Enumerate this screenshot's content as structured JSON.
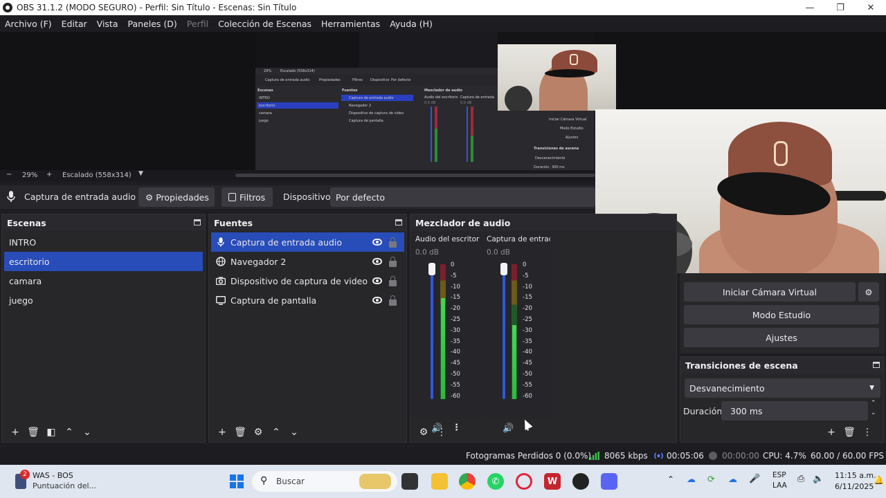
{
  "window": {
    "title": "OBS 31.1.2 (MODO SEGURO) - Perfil: Sin Título - Escenas: Sin Título",
    "controls": [
      "—",
      "❐",
      "✕"
    ]
  },
  "menu": [
    {
      "label": "Archivo (F)",
      "enabled": true
    },
    {
      "label": "Editar",
      "enabled": true
    },
    {
      "label": "Vista",
      "enabled": true
    },
    {
      "label": "Paneles (D)",
      "enabled": true
    },
    {
      "label": "Perfil",
      "enabled": false
    },
    {
      "label": "Colección de Escenas",
      "enabled": true
    },
    {
      "label": "Herramientas",
      "enabled": true
    },
    {
      "label": "Ayuda (H)",
      "enabled": true
    }
  ],
  "preview": {
    "zoom_minus": "−",
    "zoom_value": "29%",
    "zoom_plus": "+",
    "scaling": "Escalado (558x314)"
  },
  "source_toolbar": {
    "source_name": "Captura de entrada audio",
    "properties_label": "Propiedades",
    "filters_label": "Filtros",
    "device_label": "Dispositivo",
    "device_value": "Por defecto"
  },
  "scenes": {
    "title": "Escenas",
    "items": [
      {
        "label": "INTRO",
        "selected": false
      },
      {
        "label": "escritorio",
        "selected": true
      },
      {
        "label": "camara",
        "selected": false
      },
      {
        "label": "juego",
        "selected": false
      }
    ]
  },
  "sources": {
    "title": "Fuentes",
    "items": [
      {
        "label": "Captura de entrada audio",
        "icon": "microphone-icon",
        "selected": true
      },
      {
        "label": "Navegador 2",
        "icon": "globe-icon",
        "selected": false
      },
      {
        "label": "Dispositivo de captura de video",
        "icon": "camera-icon",
        "selected": false
      },
      {
        "label": "Captura de pantalla",
        "icon": "monitor-icon",
        "selected": false
      }
    ]
  },
  "mixer": {
    "title": "Mezclador de audio",
    "channels": [
      {
        "name": "Audio del escritorio",
        "db": "0.0 dB",
        "level": 0.75
      },
      {
        "name": "Captura de entrada audio",
        "db": "0.0 dB",
        "level": 0.55
      }
    ],
    "scale": [
      "0",
      "-5",
      "-10",
      "-15",
      "-20",
      "-25",
      "-30",
      "-35",
      "-40",
      "-45",
      "-50",
      "-55",
      "-60"
    ]
  },
  "controls": {
    "virtual_cam_label": "Iniciar Cámara Virtual",
    "studio_label": "Modo Estudio",
    "settings_label": "Ajustes"
  },
  "transitions": {
    "title": "Transiciones de escena",
    "selected": "Desvanecimiento",
    "duration_label": "Duración",
    "duration_value": "300 ms"
  },
  "status": {
    "dropped_frames": "Fotogramas Perdidos 0 (0.0%)",
    "bitrate": "8065 kbps",
    "stream_time": "00:05:06",
    "record_time": "00:00:00",
    "cpu": "CPU: 4.7%",
    "fps": "60.00 / 60.00 FPS"
  },
  "taskbar": {
    "notif_title": "WAS - BOS",
    "notif_sub": "Puntuación del...",
    "notif_badge": "2",
    "search_placeholder": "Buscar",
    "lang": "ESP",
    "lang2": "LAA",
    "time": "11:15 a.m.",
    "date": "6/11/2025"
  },
  "nested_preview": {
    "source_name": "Captura de entrada audio",
    "properties": "Propiedades",
    "filters": "Filtros",
    "device": "Dispositivo",
    "device_value": "Por defecto",
    "scenes": "Escenas",
    "sources": "Fuentes",
    "mixer": "Mezclador de audio",
    "scene_items": [
      "INTRO",
      "escritorio",
      "camara",
      "juego"
    ],
    "source_items": [
      "Captura de entrada audio",
      "Navegador 2",
      "Dispositivo de captura de video",
      "Captura de pantalla"
    ],
    "ch1": "Audio del escritorio",
    "ch2": "Captura de entrada",
    "db1": "0.0 dB",
    "db2": "0.0 dB",
    "btn1": "Iniciar Cámara Virtual",
    "btn2": "Modo Estudio",
    "btn3": "Ajustes",
    "trans": "Transiciones de escena",
    "trans_sel": "Desvanecimiento",
    "dur": "Duración",
    "dur_val": "300 ms",
    "zoom": "29%",
    "scaling": "Escalado (558x314)"
  }
}
